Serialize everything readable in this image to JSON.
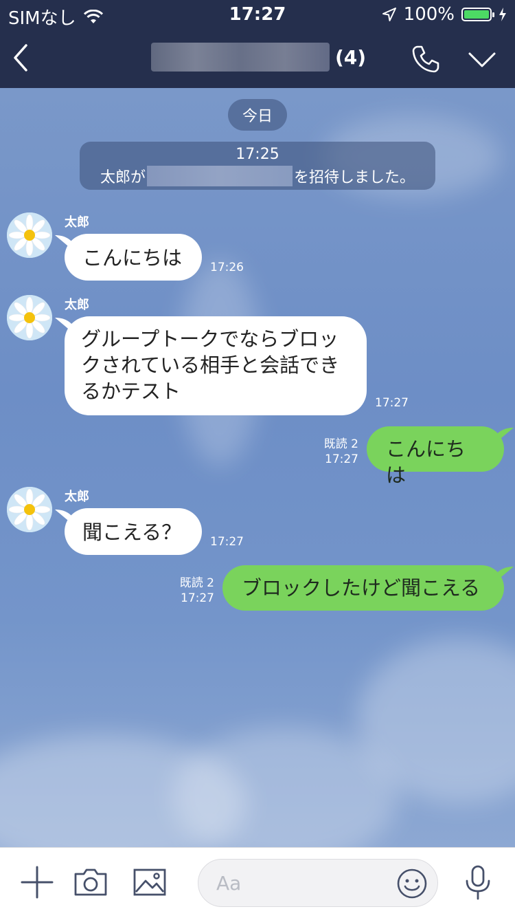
{
  "status_bar": {
    "carrier": "SIMなし",
    "time": "17:27",
    "battery": "100%"
  },
  "nav": {
    "member_count": "(4)"
  },
  "chat": {
    "date_label": "今日",
    "system_message": {
      "time": "17:25",
      "prefix": "太郎が",
      "suffix": "を招待しました。"
    },
    "messages": [
      {
        "sender": "太郎",
        "text": "こんにちは",
        "time": "17:26"
      },
      {
        "sender": "太郎",
        "lines": [
          "グループトークでならブロッ",
          "クされている相手と会話でき",
          "るかテスト"
        ],
        "time": "17:27"
      },
      {
        "text": "こんにちは",
        "read": "既読 2",
        "time": "17:27"
      },
      {
        "sender": "太郎",
        "text": "聞こえる？",
        "time": "17:27"
      },
      {
        "text": "ブロックしたけど聞こえる",
        "read": "既読 2",
        "time": "17:27"
      }
    ]
  },
  "input_bar": {
    "placeholder": "Aa"
  },
  "colors": {
    "header": "#252f4d",
    "chat_bg": "#7191c4",
    "outgoing_bubble": "#7ad35c",
    "incoming_bubble": "#ffffff"
  }
}
